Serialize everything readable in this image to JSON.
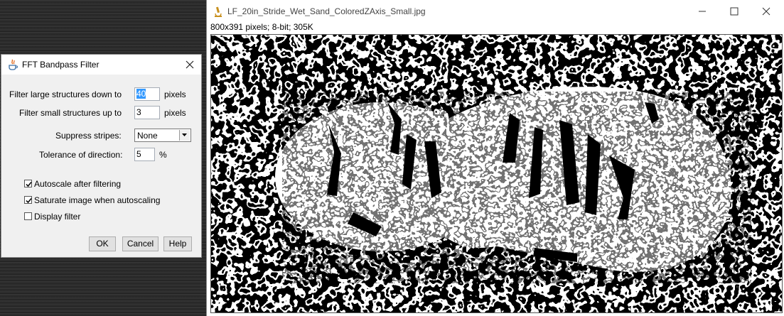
{
  "dialog": {
    "title": "FFT Bandpass Filter",
    "large_label": "Filter large structures down to",
    "large_value": "40",
    "large_unit": "pixels",
    "small_label": "Filter small structures up to",
    "small_value": "3",
    "small_unit": "pixels",
    "stripes_label": "Suppress stripes:",
    "stripes_value": "None",
    "tolerance_label": "Tolerance of direction:",
    "tolerance_value": "5",
    "tolerance_unit": "%",
    "autoscale_label": "Autoscale after filtering",
    "autoscale_checked": true,
    "saturate_label": "Saturate image when autoscaling",
    "saturate_checked": true,
    "display_label": "Display filter",
    "display_checked": false,
    "ok": "OK",
    "cancel": "Cancel",
    "help": "Help"
  },
  "image_window": {
    "title": "LF_20in_Stride_Wet_Sand_ColoredZAxis_Small.jpg",
    "info": "800x391 pixels; 8-bit; 305K"
  }
}
